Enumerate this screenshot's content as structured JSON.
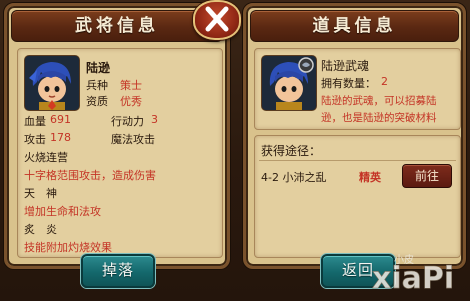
{
  "hero_panel": {
    "title": "武将信息",
    "name": "陆逊",
    "class_label": "兵种",
    "class_value": "策士",
    "aptitude_label": "资质",
    "aptitude_value": "优秀",
    "hp_label": "血量",
    "hp_value": "691",
    "ap_label": "行动力",
    "ap_value": "3",
    "attack_label": "攻击",
    "attack_value": "178",
    "attack_type": "魔法攻击",
    "skill1_name": "火烧连营",
    "skill1_desc": "十字格范围攻击，造成伤害",
    "skill2_name": "天　神",
    "skill2_desc": "增加生命和法攻",
    "skill3_name": "炙　炎",
    "skill3_desc": "技能附加灼烧效果",
    "drop_button": "掉落"
  },
  "item_panel": {
    "title": "道具信息",
    "item_name": "陆逊武魂",
    "owned_label": "拥有数量：",
    "owned_value": "2",
    "description_line1": "陆逊的武魂，可以招募陆",
    "description_line2": "逊，也是陆逊的突破材料",
    "source_title": "获得途径：",
    "source_stage": "4-2 小沛之乱",
    "source_tier": "精英",
    "goto_button": "前往",
    "back_button": "返回"
  },
  "watermark": {
    "text": "xiaPi",
    "small_text": "小皮"
  },
  "colors": {
    "panel_bg": "#d9c28c",
    "title_bar": "#5a2812",
    "highlight_red": "#c43426",
    "teal_button": "#14686c"
  }
}
